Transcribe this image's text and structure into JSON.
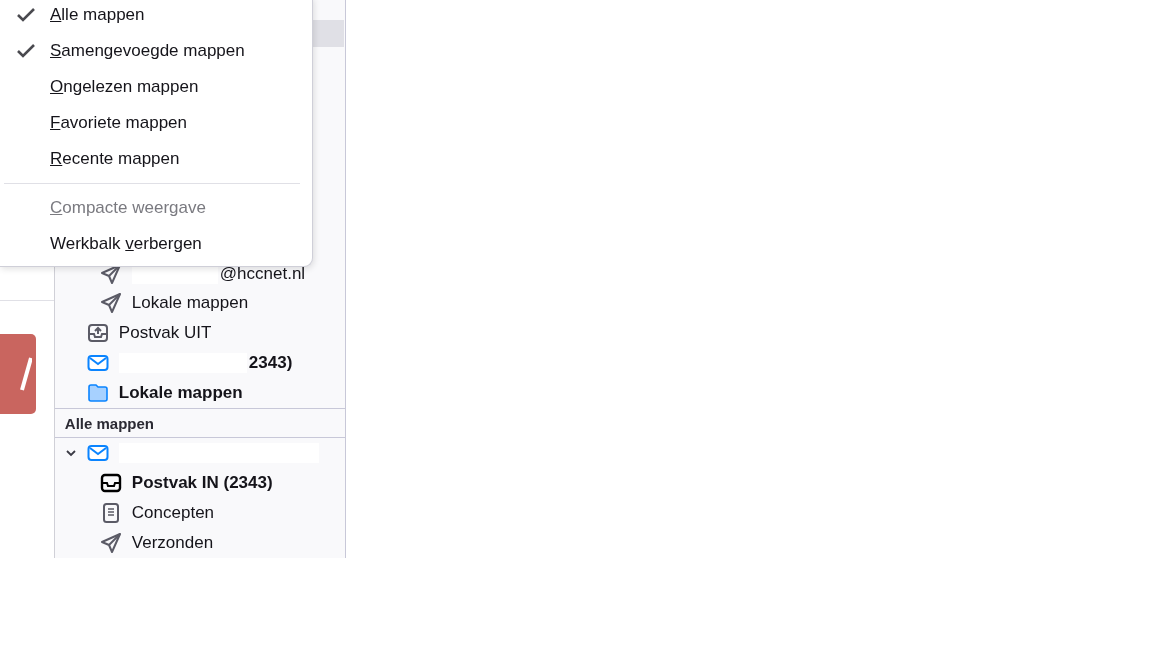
{
  "view_menu": {
    "items": [
      {
        "kind": "check",
        "label": {
          "key": "A",
          "after": "lle mappen"
        },
        "checked": true,
        "disabled": false
      },
      {
        "kind": "check",
        "label": {
          "key": "S",
          "after": "amengevoegde mappen"
        },
        "checked": true,
        "disabled": false
      },
      {
        "kind": "check",
        "label": {
          "key": "O",
          "after": "ngelezen mappen"
        },
        "checked": false,
        "disabled": false
      },
      {
        "kind": "check",
        "label": {
          "key": "F",
          "after": "avoriete mappen"
        },
        "checked": false,
        "disabled": false
      },
      {
        "kind": "check",
        "label": {
          "key": "R",
          "after": "ecente mappen"
        },
        "checked": false,
        "disabled": false
      },
      {
        "kind": "separator"
      },
      {
        "kind": "action",
        "label": {
          "key": "C",
          "after": "ompacte weergave"
        },
        "checked": false,
        "disabled": true
      },
      {
        "kind": "action",
        "label": {
          "before": "Werkbalk ",
          "key": "v",
          "after": "erbergen"
        },
        "checked": false,
        "disabled": false
      }
    ]
  },
  "unified_folders": {
    "partial_children": [
      {
        "kind": "sent",
        "label": "@hccnet.nl",
        "bold": false,
        "redacted": true
      },
      {
        "kind": "sent",
        "label": "Lokale mappen",
        "bold": false,
        "redacted": false
      }
    ],
    "items": [
      {
        "kind": "outbox",
        "label": "Postvak UIT",
        "bold": false,
        "redacted": false
      },
      {
        "kind": "account",
        "label": "2343)",
        "bold": true,
        "redacted": true
      },
      {
        "kind": "local",
        "label": "Lokale mappen",
        "bold": true,
        "redacted": false
      }
    ]
  },
  "all_folders": {
    "header": "Alle mappen",
    "accounts": [
      {
        "kind": "account",
        "expanded": true,
        "redacted": true,
        "children": [
          {
            "kind": "inbox",
            "label": "Postvak IN (2343)",
            "bold": true
          },
          {
            "kind": "drafts",
            "label": "Concepten",
            "bold": false
          },
          {
            "kind": "sent",
            "label": "Verzonden",
            "bold": false
          }
        ]
      }
    ]
  }
}
